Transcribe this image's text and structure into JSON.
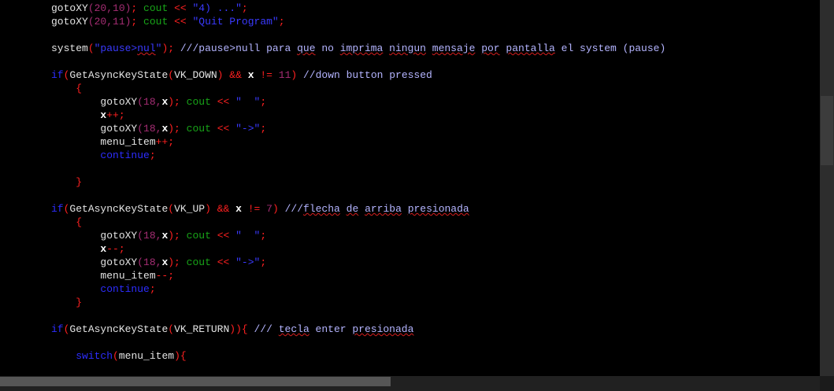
{
  "colors": {
    "background": "#000000",
    "plain": "#e4e4e4",
    "number": "#a62d74",
    "punctuation": "#ff2020",
    "keyword": "#2d2dff",
    "string": "#3a3aff",
    "cout": "#18a418",
    "comment": "#b4b4ff"
  },
  "lines": [
    [
      [
        "plain",
        "gotoXY"
      ],
      [
        "num",
        "(20,10)"
      ],
      [
        "punct",
        ";"
      ],
      [
        "plain",
        " "
      ],
      [
        "cout",
        "cout"
      ],
      [
        "plain",
        " "
      ],
      [
        "punct",
        "<<"
      ],
      [
        "plain",
        " "
      ],
      [
        "str",
        "\"4) ...\""
      ],
      [
        "punct",
        ";"
      ]
    ],
    [
      [
        "plain",
        "gotoXY"
      ],
      [
        "num",
        "(20,11)"
      ],
      [
        "punct",
        ";"
      ],
      [
        "plain",
        " "
      ],
      [
        "cout",
        "cout"
      ],
      [
        "plain",
        " "
      ],
      [
        "punct",
        "<<"
      ],
      [
        "plain",
        " "
      ],
      [
        "str",
        "\"Quit Program\""
      ],
      [
        "punct",
        ";"
      ]
    ],
    [],
    [
      [
        "plain",
        "system"
      ],
      [
        "punct",
        "("
      ],
      [
        "str",
        "\"pause>"
      ],
      [
        "str_sq",
        "nul"
      ],
      [
        "str",
        "\""
      ],
      [
        "punct",
        ");"
      ],
      [
        "plain",
        " "
      ],
      [
        "cmt",
        "///pause>null para "
      ],
      [
        "cmt_sq",
        "que"
      ],
      [
        "cmt",
        " no "
      ],
      [
        "cmt_sq",
        "imprima"
      ],
      [
        "cmt",
        " "
      ],
      [
        "cmt_sq",
        "ningun"
      ],
      [
        "cmt",
        " "
      ],
      [
        "cmt_sq",
        "mensaje"
      ],
      [
        "cmt",
        " "
      ],
      [
        "cmt_sq",
        "por"
      ],
      [
        "cmt",
        " "
      ],
      [
        "cmt_sq",
        "pantalla"
      ],
      [
        "cmt",
        " el system (pause)"
      ]
    ],
    [],
    [
      [
        "kw",
        "if"
      ],
      [
        "punct",
        "("
      ],
      [
        "plain",
        "GetAsyncKeyState"
      ],
      [
        "punct",
        "("
      ],
      [
        "plain",
        "VK_DOWN"
      ],
      [
        "punct",
        ")"
      ],
      [
        "plain",
        " "
      ],
      [
        "punct",
        "&&"
      ],
      [
        "plain",
        " "
      ],
      [
        "bold",
        "x"
      ],
      [
        "plain",
        " "
      ],
      [
        "punct",
        "!="
      ],
      [
        "plain",
        " "
      ],
      [
        "num",
        "11"
      ],
      [
        "punct",
        ")"
      ],
      [
        "plain",
        " "
      ],
      [
        "cmt",
        "//down button pressed"
      ]
    ],
    [
      [
        "plain",
        "    "
      ],
      [
        "punct",
        "{"
      ]
    ],
    [
      [
        "plain",
        "        gotoXY"
      ],
      [
        "num",
        "(18,"
      ],
      [
        "bold",
        "x"
      ],
      [
        "punct",
        ");"
      ],
      [
        "plain",
        " "
      ],
      [
        "cout",
        "cout"
      ],
      [
        "plain",
        " "
      ],
      [
        "punct",
        "<<"
      ],
      [
        "plain",
        " "
      ],
      [
        "str",
        "\"  \""
      ],
      [
        "punct",
        ";"
      ]
    ],
    [
      [
        "plain",
        "        "
      ],
      [
        "bold",
        "x"
      ],
      [
        "punct",
        "++;"
      ]
    ],
    [
      [
        "plain",
        "        gotoXY"
      ],
      [
        "num",
        "(18,"
      ],
      [
        "bold",
        "x"
      ],
      [
        "punct",
        ");"
      ],
      [
        "plain",
        " "
      ],
      [
        "cout",
        "cout"
      ],
      [
        "plain",
        " "
      ],
      [
        "punct",
        "<<"
      ],
      [
        "plain",
        " "
      ],
      [
        "str",
        "\"->\""
      ],
      [
        "punct",
        ";"
      ]
    ],
    [
      [
        "plain",
        "        menu_item"
      ],
      [
        "punct",
        "++;"
      ]
    ],
    [
      [
        "plain",
        "        "
      ],
      [
        "kw",
        "continue"
      ],
      [
        "punct",
        ";"
      ]
    ],
    [],
    [
      [
        "plain",
        "    "
      ],
      [
        "punct",
        "}"
      ]
    ],
    [],
    [
      [
        "kw",
        "if"
      ],
      [
        "punct",
        "("
      ],
      [
        "plain",
        "GetAsyncKeyState"
      ],
      [
        "punct",
        "("
      ],
      [
        "plain",
        "VK_UP"
      ],
      [
        "punct",
        ")"
      ],
      [
        "plain",
        " "
      ],
      [
        "punct",
        "&&"
      ],
      [
        "plain",
        " "
      ],
      [
        "bold",
        "x"
      ],
      [
        "plain",
        " "
      ],
      [
        "punct",
        "!="
      ],
      [
        "plain",
        " "
      ],
      [
        "num",
        "7"
      ],
      [
        "punct",
        ")"
      ],
      [
        "plain",
        " "
      ],
      [
        "cmt",
        "///"
      ],
      [
        "cmt_sq",
        "flecha"
      ],
      [
        "cmt",
        " "
      ],
      [
        "cmt_sq",
        "de"
      ],
      [
        "cmt",
        " "
      ],
      [
        "cmt_sq",
        "arriba"
      ],
      [
        "cmt",
        " "
      ],
      [
        "cmt_sq",
        "presionada"
      ]
    ],
    [
      [
        "plain",
        "    "
      ],
      [
        "punct",
        "{"
      ]
    ],
    [
      [
        "plain",
        "        gotoXY"
      ],
      [
        "num",
        "(18,"
      ],
      [
        "bold",
        "x"
      ],
      [
        "punct",
        ");"
      ],
      [
        "plain",
        " "
      ],
      [
        "cout",
        "cout"
      ],
      [
        "plain",
        " "
      ],
      [
        "punct",
        "<<"
      ],
      [
        "plain",
        " "
      ],
      [
        "str",
        "\"  \""
      ],
      [
        "punct",
        ";"
      ]
    ],
    [
      [
        "plain",
        "        "
      ],
      [
        "bold",
        "x"
      ],
      [
        "punct",
        "--;"
      ]
    ],
    [
      [
        "plain",
        "        gotoXY"
      ],
      [
        "num",
        "(18,"
      ],
      [
        "bold",
        "x"
      ],
      [
        "punct",
        ");"
      ],
      [
        "plain",
        " "
      ],
      [
        "cout",
        "cout"
      ],
      [
        "plain",
        " "
      ],
      [
        "punct",
        "<<"
      ],
      [
        "plain",
        " "
      ],
      [
        "str",
        "\"->\""
      ],
      [
        "punct",
        ";"
      ]
    ],
    [
      [
        "plain",
        "        menu_item"
      ],
      [
        "punct",
        "--;"
      ]
    ],
    [
      [
        "plain",
        "        "
      ],
      [
        "kw",
        "continue"
      ],
      [
        "punct",
        ";"
      ]
    ],
    [
      [
        "plain",
        "    "
      ],
      [
        "punct",
        "}"
      ]
    ],
    [],
    [
      [
        "kw",
        "if"
      ],
      [
        "punct",
        "("
      ],
      [
        "plain",
        "GetAsyncKeyState"
      ],
      [
        "punct",
        "("
      ],
      [
        "plain",
        "VK_RETURN"
      ],
      [
        "punct",
        "))"
      ],
      [
        "punct",
        "{"
      ],
      [
        "plain",
        " "
      ],
      [
        "cmt",
        "/// "
      ],
      [
        "cmt_sq",
        "tecla"
      ],
      [
        "cmt",
        " enter "
      ],
      [
        "cmt_sq",
        "presionada"
      ]
    ],
    [],
    [
      [
        "plain",
        "    "
      ],
      [
        "kw",
        "switch"
      ],
      [
        "punct",
        "("
      ],
      [
        "plain",
        "menu_item"
      ],
      [
        "punct",
        "){"
      ]
    ]
  ]
}
